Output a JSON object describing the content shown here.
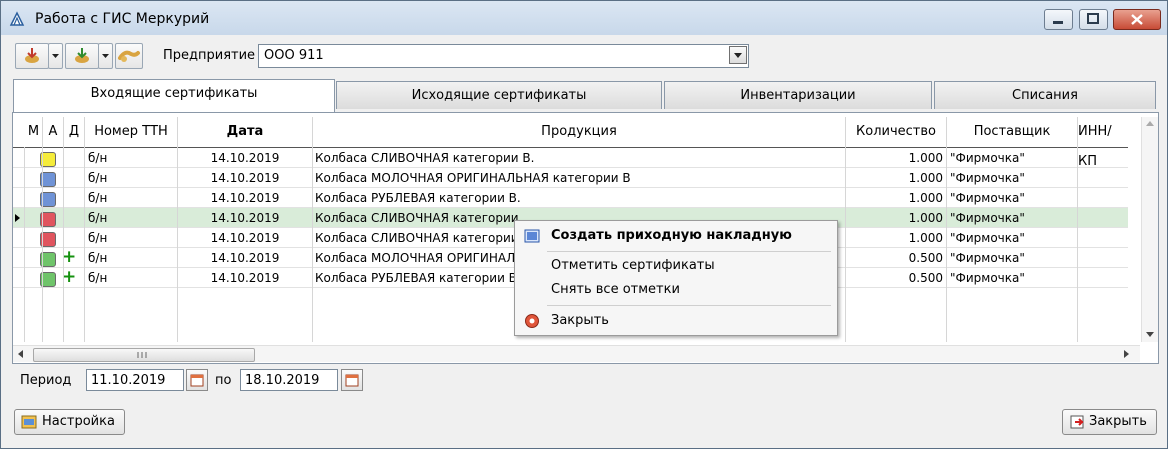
{
  "window": {
    "title": "Работа с ГИС Меркурий"
  },
  "toolbar": {
    "enterprise_label": "Предприятие",
    "enterprise_value": "ООО 911"
  },
  "tabs": [
    {
      "label": "Входящие сертификаты"
    },
    {
      "label": "Исходящие сертификаты"
    },
    {
      "label": "Инвентаризации"
    },
    {
      "label": "Списания"
    }
  ],
  "table": {
    "columns": [
      "М",
      "А",
      "Д",
      "Номер ТТН",
      "Дата",
      "Продукция",
      "Количество",
      "Поставщик",
      "ИНН/КП"
    ],
    "rows": [
      {
        "status": "#f5ec3a",
        "check": "",
        "ttn": "б/н",
        "date": "14.10.2019",
        "product": "Колбаса  СЛИВОЧНАЯ категории В.",
        "qty": "1.000",
        "supplier": "\"Фирмочка\""
      },
      {
        "status": "#6f93d6",
        "check": "",
        "ttn": "б/н",
        "date": "14.10.2019",
        "product": "Колбаса МОЛОЧНАЯ ОРИГИНАЛЬНАЯ категории В",
        "qty": "1.000",
        "supplier": "\"Фирмочка\""
      },
      {
        "status": "#6f93d6",
        "check": "",
        "ttn": "б/н",
        "date": "14.10.2019",
        "product": "Колбаса РУБЛЕВАЯ категории В.",
        "qty": "1.000",
        "supplier": "\"Фирмочка\""
      },
      {
        "status": "#e0555f",
        "check": "",
        "ttn": "б/н",
        "date": "14.10.2019",
        "product": "Колбаса  СЛИВОЧНАЯ категории",
        "qty": "1.000",
        "supplier": "\"Фирмочка\""
      },
      {
        "status": "#e0555f",
        "check": "",
        "ttn": "б/н",
        "date": "14.10.2019",
        "product": "Колбаса  СЛИВОЧНАЯ категории",
        "qty": "1.000",
        "supplier": "\"Фирмочка\""
      },
      {
        "status": "#6fc46a",
        "check": "+",
        "ttn": "б/н",
        "date": "14.10.2019",
        "product": "Колбаса МОЛОЧНАЯ ОРИГИНАЛЬ",
        "qty": "0.500",
        "supplier": "\"Фирмочка\""
      },
      {
        "status": "#6fc46a",
        "check": "+",
        "ttn": "б/н",
        "date": "14.10.2019",
        "product": "Колбаса РУБЛЕВАЯ категории В",
        "qty": "0.500",
        "supplier": "\"Фирмочка\""
      }
    ]
  },
  "period": {
    "label": "Период",
    "from": "11.10.2019",
    "to_label": "по",
    "to": "18.10.2019"
  },
  "buttons": {
    "settings": "Настройка",
    "close": "Закрыть"
  },
  "context_menu": {
    "items": [
      "Создать приходную накладную",
      "Отметить сертификаты",
      "Снять все отметки",
      "Закрыть"
    ]
  },
  "colors": {
    "selected_row": "#d9ecd9",
    "grid_line": "#d6d6d6"
  }
}
